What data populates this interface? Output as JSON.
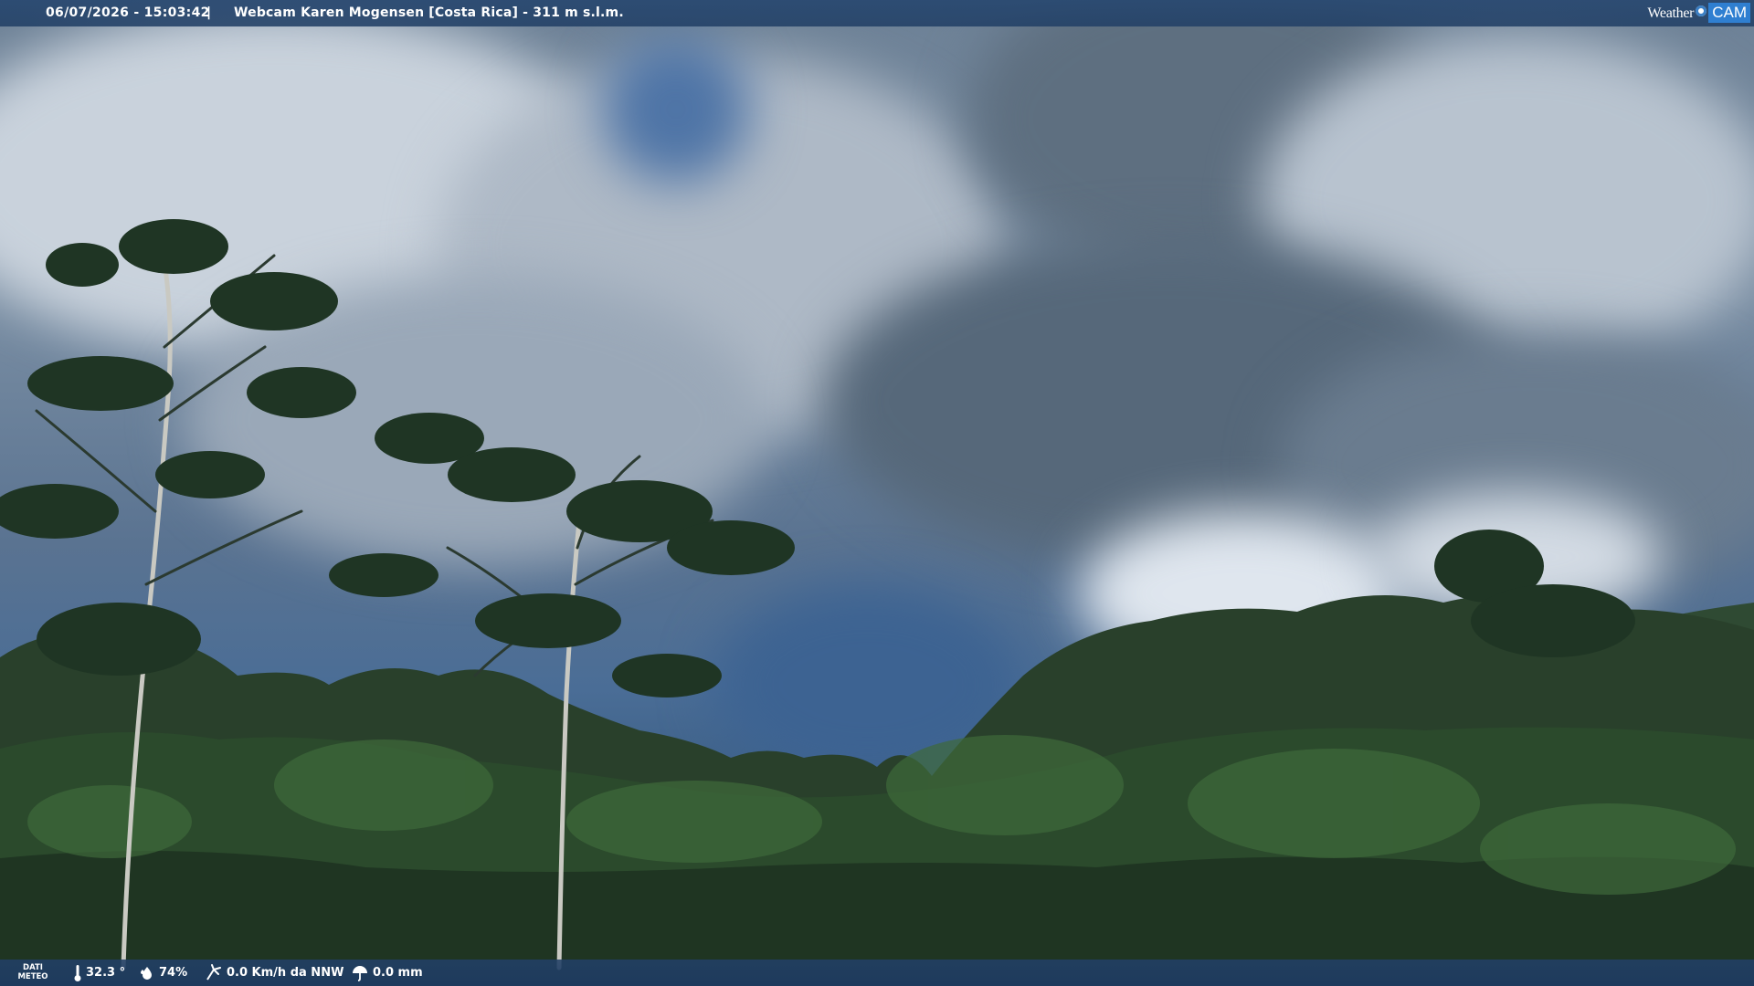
{
  "overlay": {
    "datetime": "06/07/2026 - 15:03:42",
    "separator": "|",
    "location": "Webcam Karen Mogensen [Costa Rica]  - 311 m s.l.m.",
    "brand": {
      "word": "Weather",
      "cam": "CAM"
    }
  },
  "weather": {
    "label_line1": "DATI",
    "label_line2": "METEO",
    "temperature": "32.3 °",
    "humidity": "74%",
    "wind": "0.0 Km/h da NNW",
    "rain": "0.0 mm"
  },
  "icons": {
    "temperature": "thermometer-icon",
    "humidity": "humidity-drop-icon",
    "wind": "wind-icon",
    "rain": "rain-umbrella-icon"
  },
  "colors": {
    "bar": "#284870",
    "brand_accent": "#2f7fd1",
    "text": "#ffffff"
  }
}
